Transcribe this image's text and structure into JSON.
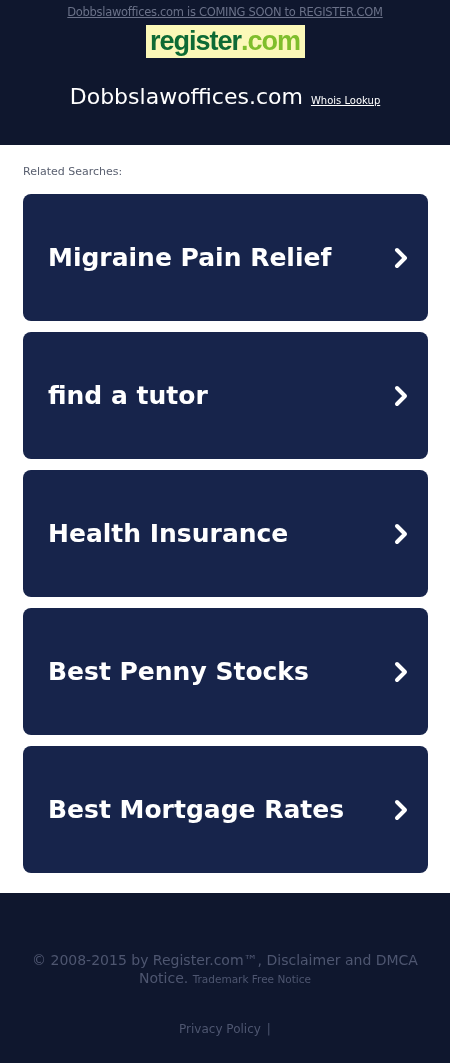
{
  "header": {
    "notice": "Dobbslawoffices.com is COMING SOON to REGISTER.COM",
    "logo": {
      "name": "register",
      "suffix": ".com"
    },
    "domain": "Dobbslawoffices.com",
    "whois_link": "Whois Lookup"
  },
  "related": {
    "heading": "Related Searches:",
    "items": [
      {
        "label": "Migraine Pain Relief"
      },
      {
        "label": "find a tutor"
      },
      {
        "label": "Health Insurance"
      },
      {
        "label": "Best Penny Stocks"
      },
      {
        "label": "Best Mortgage Rates"
      }
    ]
  },
  "footer": {
    "copyright": "© 2008-2015 by Register.com™, Disclaimer and DMCA Notice.",
    "trademark_link": "Trademark Free Notice",
    "links": [
      "Privacy Policy"
    ],
    "separator": "|"
  }
}
